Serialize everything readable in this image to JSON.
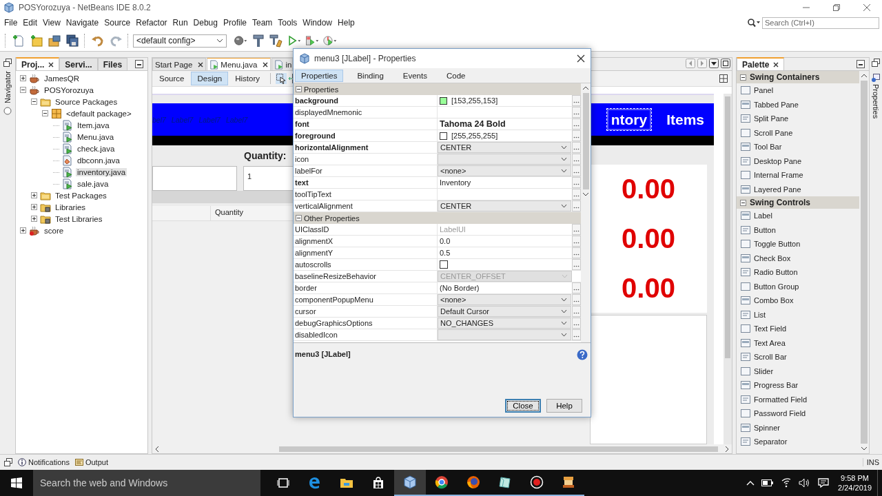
{
  "window": {
    "title": "POSYorozuya - NetBeans IDE 8.0.2"
  },
  "menu": [
    "File",
    "Edit",
    "View",
    "Navigate",
    "Source",
    "Refactor",
    "Run",
    "Debug",
    "Profile",
    "Team",
    "Tools",
    "Window",
    "Help"
  ],
  "search": {
    "placeholder": "Search (Ctrl+I)"
  },
  "toolbar": {
    "config": "<default config>"
  },
  "navigator": {
    "label": "Navigator"
  },
  "projects": {
    "tabs": [
      {
        "label": "Proj...",
        "selected": true,
        "closable": true
      },
      {
        "label": "Servi...",
        "selected": false,
        "closable": false
      },
      {
        "label": "Files",
        "selected": false,
        "closable": false
      }
    ],
    "tree": [
      {
        "label": "JamesQR",
        "kind": "project",
        "expanded": false,
        "selected": false
      },
      {
        "label": "POSYorozuya",
        "kind": "project",
        "expanded": true,
        "selected": false,
        "children": [
          {
            "label": "Source Packages",
            "kind": "folder",
            "expanded": true,
            "selected": false,
            "children": [
              {
                "label": "<default package>",
                "kind": "package",
                "expanded": true,
                "selected": false,
                "children": [
                  {
                    "label": "Item.java",
                    "kind": "runnable",
                    "selected": false
                  },
                  {
                    "label": "Menu.java",
                    "kind": "runnable",
                    "selected": false
                  },
                  {
                    "label": "check.java",
                    "kind": "runnable",
                    "selected": false
                  },
                  {
                    "label": "dbconn.java",
                    "kind": "class",
                    "selected": false
                  },
                  {
                    "label": "inventory.java",
                    "kind": "runnable",
                    "selected": true
                  },
                  {
                    "label": "sale.java",
                    "kind": "runnable",
                    "selected": false
                  }
                ]
              }
            ]
          },
          {
            "label": "Test Packages",
            "kind": "folder",
            "expanded": false,
            "selected": false
          },
          {
            "label": "Libraries",
            "kind": "library",
            "expanded": false,
            "selected": false
          },
          {
            "label": "Test Libraries",
            "kind": "library",
            "expanded": false,
            "selected": false
          }
        ]
      },
      {
        "label": "score",
        "kind": "project-error",
        "expanded": false,
        "selected": false
      }
    ]
  },
  "editor": {
    "tabs": [
      {
        "label": "Start Page",
        "selected": false,
        "closable": true
      },
      {
        "label": "Menu.java",
        "selected": true,
        "closable": true
      },
      {
        "label": "in",
        "selected": false,
        "closable": false
      }
    ],
    "views": [
      {
        "label": "Source",
        "selected": false
      },
      {
        "label": "Design",
        "selected": true
      },
      {
        "label": "History",
        "selected": false
      }
    ]
  },
  "designer": {
    "header_labels": [
      "bel7",
      "Label7",
      "Label7",
      "Label7"
    ],
    "menu_labels": [
      {
        "text": "ntory",
        "selected": true
      },
      {
        "text": "Items",
        "selected": false
      }
    ],
    "quantity_label": "Quantity:",
    "quantity_value": "1",
    "table_columns": [
      "Quantity"
    ],
    "totals": [
      "0.00",
      "0.00",
      "0.00"
    ]
  },
  "palette": {
    "title": "Palette",
    "sections": [
      {
        "title": "Swing Containers",
        "expanded": true,
        "items": [
          "Panel",
          "Tabbed Pane",
          "Split Pane",
          "Scroll Pane",
          "Tool Bar",
          "Desktop Pane",
          "Internal Frame",
          "Layered Pane"
        ]
      },
      {
        "title": "Swing Controls",
        "expanded": true,
        "items": [
          "Label",
          "Button",
          "Toggle Button",
          "Check Box",
          "Radio Button",
          "Button Group",
          "Combo Box",
          "List",
          "Text Field",
          "Text Area",
          "Scroll Bar",
          "Slider",
          "Progress Bar",
          "Formatted Field",
          "Password Field",
          "Spinner",
          "Separator"
        ]
      }
    ]
  },
  "properties_strip": {
    "label": "Properties"
  },
  "dialog": {
    "title": "menu3 [JLabel] - Properties",
    "tabs": [
      {
        "label": "Properties",
        "selected": true
      },
      {
        "label": "Binding",
        "selected": false
      },
      {
        "label": "Events",
        "selected": false
      },
      {
        "label": "Code",
        "selected": false
      }
    ],
    "sections": [
      {
        "title": "Properties",
        "expanded": true,
        "rows": [
          {
            "name": "background",
            "bold": true,
            "kind": "color",
            "value": "[153,255,153]",
            "color": "#99ff99"
          },
          {
            "name": "displayedMnemonic",
            "bold": false,
            "kind": "text"
          },
          {
            "name": "font",
            "bold": true,
            "kind": "font",
            "value": "Tahoma 24 Bold"
          },
          {
            "name": "foreground",
            "bold": true,
            "kind": "color",
            "value": "[255,255,255]",
            "color": "#ffffff"
          },
          {
            "name": "horizontalAlignment",
            "bold": true,
            "kind": "combo",
            "value": "CENTER"
          },
          {
            "name": "icon",
            "bold": false,
            "kind": "combo"
          },
          {
            "name": "labelFor",
            "bold": false,
            "kind": "combo",
            "value": "<none>"
          },
          {
            "name": "text",
            "bold": true,
            "kind": "text",
            "value": "Inventory"
          },
          {
            "name": "toolTipText",
            "bold": false,
            "kind": "text"
          },
          {
            "name": "verticalAlignment",
            "bold": false,
            "kind": "combo",
            "value": "CENTER"
          }
        ]
      },
      {
        "title": "Other Properties",
        "expanded": true,
        "rows": [
          {
            "name": "UIClassID",
            "bold": false,
            "kind": "readonly",
            "value": "LabelUI"
          },
          {
            "name": "alignmentX",
            "bold": false,
            "kind": "text",
            "value": "0.0"
          },
          {
            "name": "alignmentY",
            "bold": false,
            "kind": "text",
            "value": "0.5"
          },
          {
            "name": "autoscrolls",
            "bold": false,
            "kind": "check",
            "checked": false
          },
          {
            "name": "baselineResizeBehavior",
            "bold": false,
            "kind": "locked-combo",
            "value": "CENTER_OFFSET"
          },
          {
            "name": "border",
            "bold": false,
            "kind": "text",
            "value": "(No Border)"
          },
          {
            "name": "componentPopupMenu",
            "bold": false,
            "kind": "combo",
            "value": "<none>"
          },
          {
            "name": "cursor",
            "bold": false,
            "kind": "combo",
            "value": "Default Cursor"
          },
          {
            "name": "debugGraphicsOptions",
            "bold": false,
            "kind": "combo",
            "value": "NO_CHANGES"
          },
          {
            "name": "disabledIcon",
            "bold": false,
            "kind": "combo"
          }
        ]
      }
    ],
    "description": "menu3 [JLabel]",
    "buttons": [
      {
        "label": "Close",
        "default": true
      },
      {
        "label": "Help",
        "default": false
      }
    ]
  },
  "status": {
    "notifications": "Notifications",
    "output": "Output",
    "mode": "INS"
  },
  "taskbar": {
    "search_placeholder": "Search the web and Windows",
    "time": "9:58 PM",
    "date": "2/24/2019",
    "apps": [
      {
        "kind": "taskview",
        "running": false,
        "active": false
      },
      {
        "kind": "edge",
        "running": false,
        "active": false
      },
      {
        "kind": "explorer",
        "running": false,
        "active": false
      },
      {
        "kind": "store",
        "running": false,
        "active": false
      },
      {
        "kind": "netbeans",
        "running": true,
        "active": true
      },
      {
        "kind": "chrome",
        "running": true,
        "active": false
      },
      {
        "kind": "firefox",
        "running": true,
        "active": false
      },
      {
        "kind": "notes",
        "running": true,
        "active": false
      },
      {
        "kind": "recorder",
        "running": true,
        "active": false
      },
      {
        "kind": "installer",
        "running": true,
        "active": false
      }
    ]
  }
}
